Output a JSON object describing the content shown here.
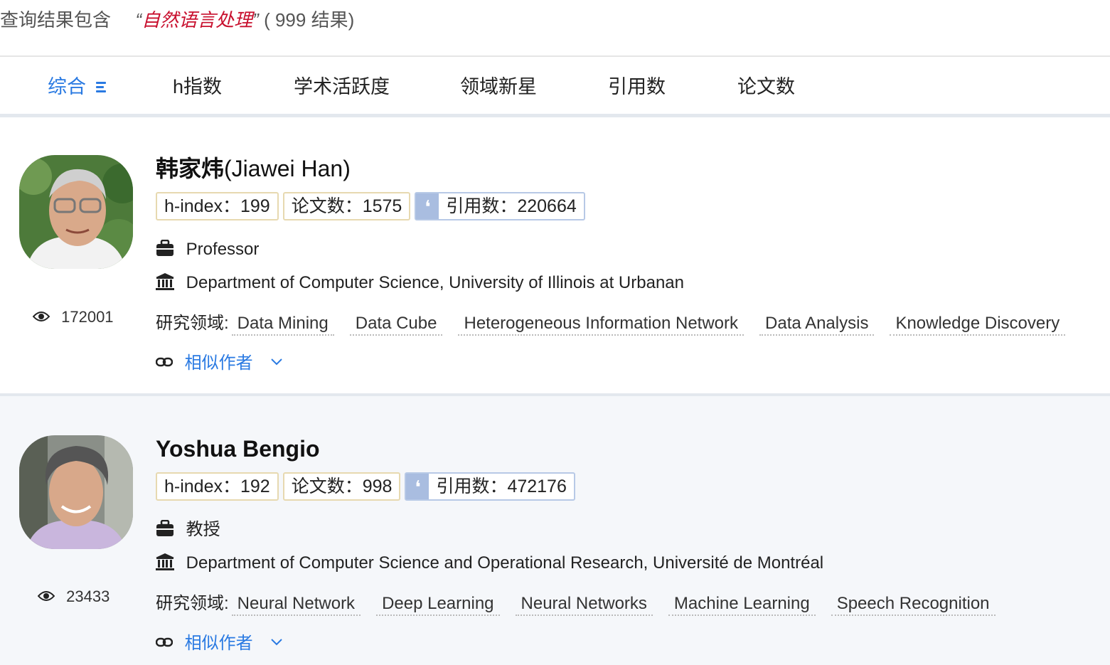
{
  "query": {
    "prefix": "查询结果包含",
    "open_quote": "“",
    "keyword": "自然语言处理",
    "close_quote": "”",
    "count_text": "( 999 结果)"
  },
  "sort_tabs": [
    {
      "label": "综合",
      "active": true
    },
    {
      "label": "h指数"
    },
    {
      "label": "学术活跃度"
    },
    {
      "label": "领域新星"
    },
    {
      "label": "引用数"
    },
    {
      "label": "论文数"
    }
  ],
  "colors": {
    "accent": "#2a7ae2",
    "keyword": "#c8102e",
    "badge_border": "#e7d9b0",
    "cite_icon_bg": "#a9bde0"
  },
  "scholars": [
    {
      "name_cn": "韩家炜",
      "name_en": "(Jiawei Han)",
      "hindex": "h-index：199",
      "papers": "论文数：1575",
      "citations": "引用数：220664",
      "views": "172001",
      "position": "Professor",
      "affiliation": "Department of Computer Science, University of Illinois at Urbanan",
      "fields_label": "研究领域:",
      "fields": [
        "Data Mining",
        "Data Cube",
        "Heterogeneous Information Network",
        "Data Analysis",
        "Knowledge Discovery"
      ],
      "similar_label": "相似作者"
    },
    {
      "name_cn": "",
      "name_en": "Yoshua Bengio",
      "hindex": "h-index：192",
      "papers": "论文数：998",
      "citations": "引用数：472176",
      "views": "23433",
      "position": "教授",
      "affiliation": "Department of Computer Science and Operational Research, Université de Montréal",
      "fields_label": "研究领域:",
      "fields": [
        "Neural Network",
        "Deep Learning",
        "Neural Networks",
        "Machine Learning",
        "Speech Recognition"
      ],
      "similar_label": "相似作者"
    }
  ]
}
